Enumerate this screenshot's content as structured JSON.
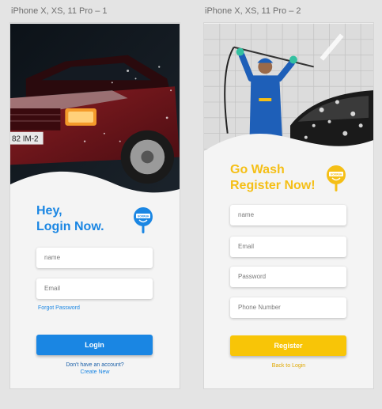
{
  "artboards": [
    {
      "title": "iPhone X, XS, 11 Pro – 1",
      "heading_line1": "Hey,",
      "heading_line2": "Login Now.",
      "logo_text": "GOWASH",
      "fields": [
        {
          "placeholder": "name"
        },
        {
          "placeholder": "Email"
        }
      ],
      "forgot_password": "Forgot Password",
      "button_label": "Login",
      "footer_line1": "Don't have an account?",
      "footer_line2": "Create New",
      "accent_color": "#1a86e3"
    },
    {
      "title": "iPhone X, XS, 11 Pro – 2",
      "heading_line1": "Go Wash",
      "heading_line2": "Register Now!",
      "logo_text": "GOWASH",
      "fields": [
        {
          "placeholder": "name"
        },
        {
          "placeholder": "Email"
        },
        {
          "placeholder": "Password"
        },
        {
          "placeholder": "Phone Number"
        }
      ],
      "button_label": "Register",
      "footer_line1": "Back to Login",
      "accent_color": "#f8c507"
    }
  ]
}
